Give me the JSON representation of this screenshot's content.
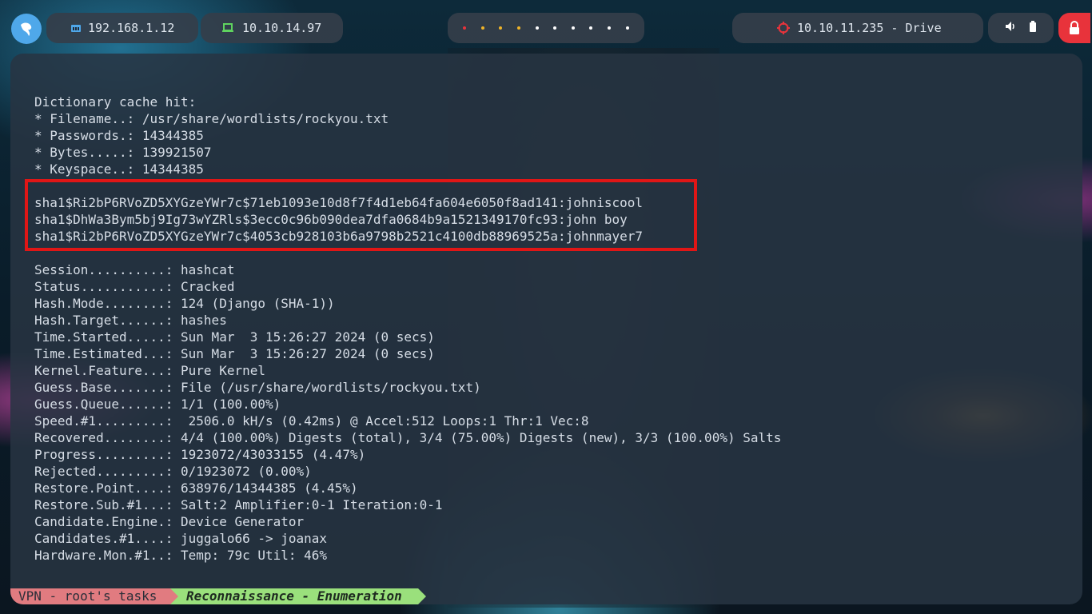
{
  "topbar": {
    "logo_icon": "kali-dragon-icon",
    "host_ip": "192.168.1.12",
    "vpn_ip": "10.10.14.97",
    "target_label": "10.10.11.235 - Drive",
    "workspaces": [
      "#e8333b",
      "#f0b429",
      "#f0b429",
      "#f0b429",
      "#ffffff",
      "#ffffff",
      "#ffffff",
      "#ffffff",
      "#ffffff",
      "#ffffff"
    ],
    "colors": {
      "logo": "#4fa8ea",
      "lock": "#e8333b",
      "host_icon": "#4fa8ea",
      "vpn_icon": "#5fd35f",
      "target_icon": "#e8333b"
    }
  },
  "terminal": {
    "lines": [
      "Dictionary cache hit:",
      "* Filename..: /usr/share/wordlists/rockyou.txt",
      "* Passwords.: 14344385",
      "* Bytes.....: 139921507",
      "* Keyspace..: 14344385",
      "",
      "sha1$Ri2bP6RVoZD5XYGzeYWr7c$71eb1093e10d8f7f4d1eb64fa604e6050f8ad141:johniscool",
      "sha1$DhWa3Bym5bj9Ig73wYZRls$3ecc0c96b090dea7dfa0684b9a1521349170fc93:john boy",
      "sha1$Ri2bP6RVoZD5XYGzeYWr7c$4053cb928103b6a9798b2521c4100db88969525a:johnmayer7",
      "",
      "Session..........: hashcat",
      "Status...........: Cracked",
      "Hash.Mode........: 124 (Django (SHA-1))",
      "Hash.Target......: hashes",
      "Time.Started.....: Sun Mar  3 15:26:27 2024 (0 secs)",
      "Time.Estimated...: Sun Mar  3 15:26:27 2024 (0 secs)",
      "Kernel.Feature...: Pure Kernel",
      "Guess.Base.......: File (/usr/share/wordlists/rockyou.txt)",
      "Guess.Queue......: 1/1 (100.00%)",
      "Speed.#1.........:  2506.0 kH/s (0.42ms) @ Accel:512 Loops:1 Thr:1 Vec:8",
      "Recovered........: 4/4 (100.00%) Digests (total), 3/4 (75.00%) Digests (new), 3/3 (100.00%) Salts",
      "Progress.........: 1923072/43033155 (4.47%)",
      "Rejected.........: 0/1923072 (0.00%)",
      "Restore.Point....: 638976/14344385 (4.45%)",
      "Restore.Sub.#1...: Salt:2 Amplifier:0-1 Iteration:0-1",
      "Candidate.Engine.: Device Generator",
      "Candidates.#1....: juggalo66 -> joanax",
      "Hardware.Mon.#1..: Temp: 79c Util: 46%"
    ]
  },
  "statusbar": {
    "session_label": "VPN - root's tasks",
    "window_label": "Reconnaissance - Enumeration"
  }
}
